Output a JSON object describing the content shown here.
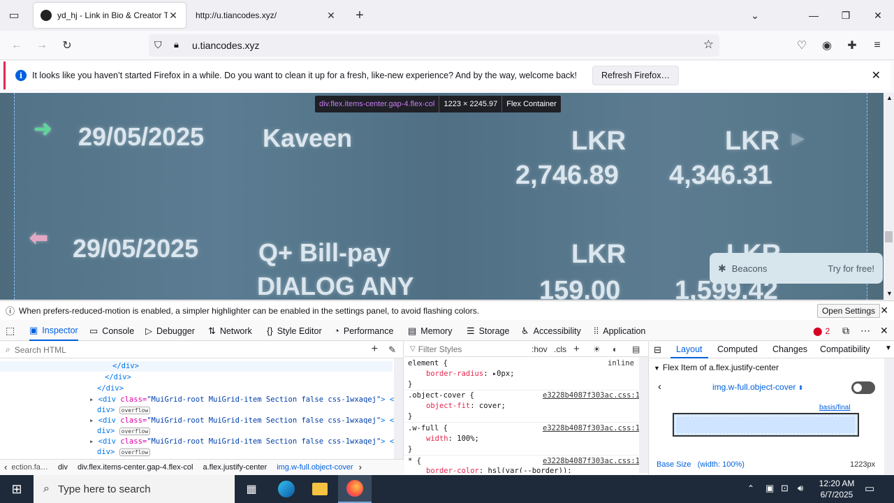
{
  "browser": {
    "tabs": [
      {
        "title": "yd_hj - Link in Bio & Creator To"
      },
      {
        "title": "http://u.tiancodes.xyz/"
      }
    ],
    "url": "u.tiancodes.xyz",
    "notification": {
      "message": "It looks like you haven’t started Firefox in a while. Do you want to clean it up for a fresh, like-new experience? And by the way, welcome back!",
      "button": "Refresh Firefox…"
    }
  },
  "page": {
    "row1": {
      "date": "29/05/2025",
      "name": "Kaveen",
      "cur1": "LKR",
      "amt1": "2,746.89",
      "cur2": "LKR",
      "amt2": "4,346.31"
    },
    "row2": {
      "date": "29/05/2025",
      "name1": "Q+ Bill-pay",
      "name2": "DIALOG ANY",
      "cur1": "LKR",
      "amt1": "159.00",
      "cur2": "LKR",
      "amt2": "1,599.42"
    },
    "tooltip": {
      "selector": "div.flex.items-center.gap-4.flex-col",
      "size": "1223 × 2245.97",
      "type": "Flex Container"
    },
    "beacons": {
      "name": "Beacons",
      "cta": "Try for free!"
    }
  },
  "devtools": {
    "notice": "When prefers-reduced-motion is enabled, a simpler highlighter can be enabled in the settings panel, to avoid flashing colors.",
    "open_settings": "Open Settings",
    "tabs": [
      "Inspector",
      "Console",
      "Debugger",
      "Network",
      "Style Editor",
      "Performance",
      "Memory",
      "Storage",
      "Accessibility",
      "Application"
    ],
    "error_count": "2",
    "search_html": "Search HTML",
    "filter_styles": "Filter Styles",
    "hov": ":hov",
    "cls": ".cls",
    "html_lines": {
      "close_div1": "</div>",
      "close_div2": "</div>",
      "close_div3": "</div>",
      "grid_open": "<div",
      "grid_class_attr": "class=",
      "grid_class_val": "\"MuiGrid-root MuiGrid-item Section false css-1wxaqej\"",
      "grid_close": "> </",
      "div_word": "div>",
      "overflow": "overflow"
    },
    "rules": [
      {
        "selector": "element {",
        "prop": "border-radius",
        "value": "0px;",
        "source": "inline"
      },
      {
        "selector": ".object-cover {",
        "prop": "object-fit",
        "value": "cover;",
        "source": "e3228b4087f303ac.css:1"
      },
      {
        "selector": ".w-full {",
        "prop": "width",
        "value": "100%;",
        "source": "e3228b4087f303ac.css:1"
      },
      {
        "selector": "* {",
        "prop": "border-color",
        "value": "hsl(var(--border));",
        "source": "e3228b4087f303ac.css:1"
      }
    ],
    "close_brace": "}",
    "sidebar_tabs": [
      "Layout",
      "Computed",
      "Changes",
      "Compatibility"
    ],
    "flex_item_of": "Flex Item of a.flex.justify-center",
    "flex_item_selector": "img.w-full.object-cover",
    "basis_final": "basis/final",
    "base_size": "Base Size",
    "base_size_note": "(width: 100%)",
    "base_size_value": "1223px",
    "breadcrumbs": [
      "ection.fa…",
      "div",
      "div.flex.items-center.gap-4.flex-col",
      "a.flex.justify-center",
      "img.w-full.object-cover"
    ]
  },
  "taskbar": {
    "search_placeholder": "Type here to search",
    "time": "12:20 AM",
    "date": "6/7/2025"
  },
  "colors": {
    "accent": "#0060df",
    "taskbar": "#1e2a3a",
    "selector_purple": "#c67cf0"
  }
}
